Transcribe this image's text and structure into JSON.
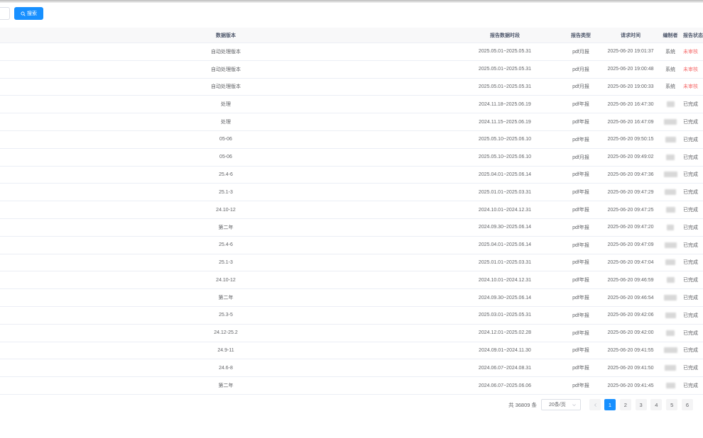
{
  "toolbar": {
    "search_label": "搜索"
  },
  "table": {
    "headers": {
      "version": "数据版本",
      "period": "报告数据时段",
      "type": "报告类型",
      "request_time": "请求时间",
      "author": "编制者",
      "status": "报告状态"
    },
    "rows": [
      {
        "version": "自动处理版本",
        "period": "2025.05.01~2025.05.31",
        "type": "pdf月报",
        "request_time": "2025-06-20 19:01:37",
        "author": "系统",
        "status": "未审核",
        "pending": true
      },
      {
        "version": "自动处理版本",
        "period": "2025.05.01~2025.05.31",
        "type": "pdf月报",
        "request_time": "2025-06-20 19:00:48",
        "author": "系统",
        "status": "未审核",
        "pending": true
      },
      {
        "version": "自动处理版本",
        "period": "2025.05.01~2025.05.31",
        "type": "pdf月报",
        "request_time": "2025-06-20 19:00:33",
        "author": "系统",
        "status": "未审核",
        "pending": true
      },
      {
        "version": "处理",
        "period": "2024.11.18~2025.06.19",
        "type": "pdf年报",
        "request_time": "2025-06-20 16:47:30",
        "author": "",
        "status": "已完成",
        "pending": false
      },
      {
        "version": "处理",
        "period": "2024.11.15~2025.06.19",
        "type": "pdf年报",
        "request_time": "2025-06-20 16:47:09",
        "author": "",
        "status": "已完成",
        "pending": false
      },
      {
        "version": "05-06",
        "period": "2025.05.10~2025.06.10",
        "type": "pdf年报",
        "request_time": "2025-06-20 09:50:15",
        "author": "",
        "status": "已完成",
        "pending": false
      },
      {
        "version": "05-06",
        "period": "2025.05.10~2025.06.10",
        "type": "pdf月报",
        "request_time": "2025-06-20 09:49:02",
        "author": "",
        "status": "已完成",
        "pending": false
      },
      {
        "version": "25.4-6",
        "period": "2025.04.01~2025.06.14",
        "type": "pdf年报",
        "request_time": "2025-06-20 09:47:36",
        "author": "",
        "status": "已完成",
        "pending": false
      },
      {
        "version": "25.1-3",
        "period": "2025.01.01~2025.03.31",
        "type": "pdf年报",
        "request_time": "2025-06-20 09:47:29",
        "author": "",
        "status": "已完成",
        "pending": false
      },
      {
        "version": "24.10-12",
        "period": "2024.10.01~2024.12.31",
        "type": "pdf年报",
        "request_time": "2025-06-20 09:47:25",
        "author": "",
        "status": "已完成",
        "pending": false
      },
      {
        "version": "第二年",
        "period": "2024.09.30~2025.06.14",
        "type": "pdf年报",
        "request_time": "2025-06-20 09:47:20",
        "author": "",
        "status": "已完成",
        "pending": false
      },
      {
        "version": "25.4-6",
        "period": "2025.04.01~2025.06.14",
        "type": "pdf年报",
        "request_time": "2025-06-20 09:47:09",
        "author": "",
        "status": "已完成",
        "pending": false
      },
      {
        "version": "25.1-3",
        "period": "2025.01.01~2025.03.31",
        "type": "pdf年报",
        "request_time": "2025-06-20 09:47:04",
        "author": "",
        "status": "已完成",
        "pending": false
      },
      {
        "version": "24.10-12",
        "period": "2024.10.01~2024.12.31",
        "type": "pdf年报",
        "request_time": "2025-06-20 09:46:59",
        "author": "",
        "status": "已完成",
        "pending": false
      },
      {
        "version": "第二年",
        "period": "2024.09.30~2025.06.14",
        "type": "pdf年报",
        "request_time": "2025-06-20 09:46:54",
        "author": "",
        "status": "已完成",
        "pending": false
      },
      {
        "version": "25.3-5",
        "period": "2025.03.01~2025.05.31",
        "type": "pdf年报",
        "request_time": "2025-06-20 09:42:06",
        "author": "",
        "status": "已完成",
        "pending": false
      },
      {
        "version": "24.12-25.2",
        "period": "2024.12.01~2025.02.28",
        "type": "pdf年报",
        "request_time": "2025-06-20 09:42:00",
        "author": "",
        "status": "已完成",
        "pending": false
      },
      {
        "version": "24.9-11",
        "period": "2024.09.01~2024.11.30",
        "type": "pdf年报",
        "request_time": "2025-06-20 09:41:55",
        "author": "",
        "status": "已完成",
        "pending": false
      },
      {
        "version": "24.6-8",
        "period": "2024.06.07~2024.08.31",
        "type": "pdf年报",
        "request_time": "2025-06-20 09:41:50",
        "author": "",
        "status": "已完成",
        "pending": false
      },
      {
        "version": "第二年",
        "period": "2024.06.07~2025.06.06",
        "type": "pdf年报",
        "request_time": "2025-06-20 09:41:45",
        "author": "",
        "status": "已完成",
        "pending": false
      }
    ]
  },
  "pagination": {
    "total": "共 36809 条",
    "page_size": "20条/页",
    "pages": [
      "1",
      "2",
      "3",
      "4",
      "5",
      "6"
    ],
    "current": "1"
  },
  "colors": {
    "accent": "#1890ff",
    "pending": "#f56c6c"
  },
  "icons": {
    "search": "search-icon",
    "prev": "chevron-left-icon",
    "select": "chevron-down-icon"
  }
}
